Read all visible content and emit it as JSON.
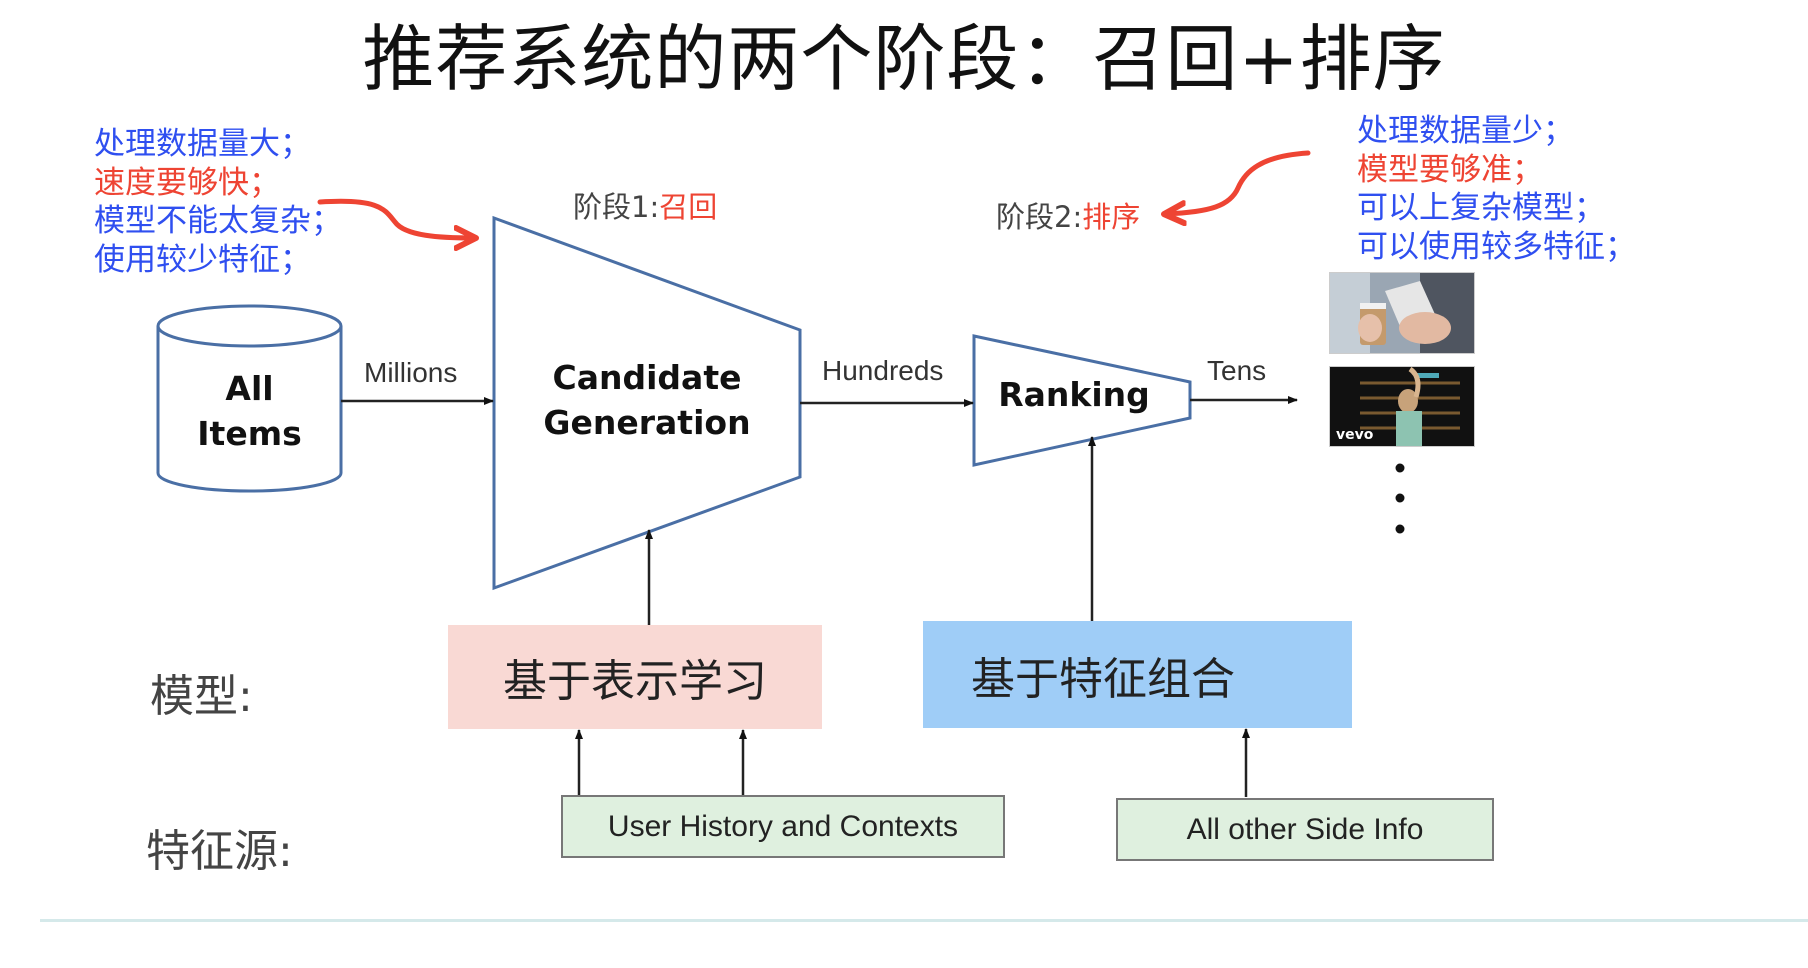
{
  "title": "推荐系统的两个阶段：召回+排序",
  "left_notes": [
    {
      "text": "处理数据量大；",
      "color": "blue"
    },
    {
      "text": "速度要够快；",
      "color": "red"
    },
    {
      "text": "模型不能太复杂；",
      "color": "blue"
    },
    {
      "text": "使用较少特征；",
      "color": "blue"
    }
  ],
  "right_notes": [
    {
      "text": "处理数据量少；",
      "color": "blue"
    },
    {
      "text": "模型要够准；",
      "color": "red"
    },
    {
      "text": "可以上复杂模型；",
      "color": "blue"
    },
    {
      "text": "可以使用较多特征；",
      "color": "blue"
    }
  ],
  "stage1": {
    "prefix": "阶段1:",
    "name": "召回"
  },
  "stage2": {
    "prefix": "阶段2:",
    "name": "排序"
  },
  "pipeline": {
    "all_items": [
      "All",
      "Items"
    ],
    "candidate_generation": [
      "Candidate",
      "Generation"
    ],
    "ranking": "Ranking",
    "flow_labels": {
      "millions": "Millions",
      "hundreds": "Hundreds",
      "tens": "Tens"
    }
  },
  "results": {
    "thumbnails": [
      {
        "subject": "hand holding phone and coffee cup"
      },
      {
        "subject": "music video",
        "badge": "vevo"
      }
    ],
    "more_indicator": "⋮"
  },
  "rows": {
    "model_label": "模型:",
    "feature_source_label": "特征源:"
  },
  "models": {
    "representation": "基于表示学习",
    "feature_combination": "基于特征组合"
  },
  "feature_sources": {
    "user_history": "User History and Contexts",
    "side_info": "All other Side Info"
  },
  "colors": {
    "note_blue": "#2f4ff0",
    "note_red": "#ee4433",
    "shape_stroke": "#4a6fa5",
    "model_pink": "#f9d9d4",
    "model_blue": "#9fcdf7",
    "source_green": "#dff0df",
    "curved_arrow": "#ee4433"
  }
}
